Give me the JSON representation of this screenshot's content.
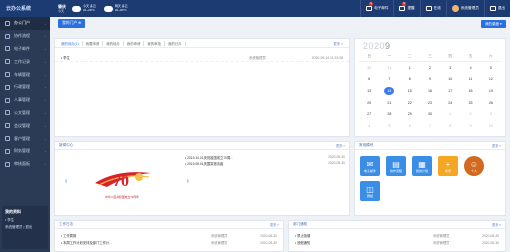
{
  "topbar": {
    "logo": "云办公系统",
    "city": "肇庆",
    "city_sub": "今天",
    "weather": [
      {
        "label": "今天 多云",
        "temp": "21~29°C"
      },
      {
        "label": "明天 多云",
        "temp": "22~30°C"
      }
    ],
    "items": [
      {
        "label": "电子邮件",
        "badge": "3"
      },
      {
        "label": "提醒",
        "badge": "5"
      },
      {
        "label": "在线",
        "badge": ""
      }
    ],
    "user": "系统管理员",
    "logout": "退出"
  },
  "sidebar": {
    "items": [
      {
        "label": "办公门户"
      },
      {
        "label": "协作流程"
      },
      {
        "label": "电子邮件"
      },
      {
        "label": "工作记录"
      },
      {
        "label": "车辆管理"
      },
      {
        "label": "行政管理"
      },
      {
        "label": "人事管理"
      },
      {
        "label": "公文管理"
      },
      {
        "label": "会议管理"
      },
      {
        "label": "客户管理"
      },
      {
        "label": "财务管理"
      },
      {
        "label": "审核面板"
      }
    ],
    "profile": {
      "title": "我的资料",
      "name": "• 李生",
      "role": "系统管理员 | 退出"
    }
  },
  "toolbar": {
    "add_label": "我的门户 ⊕",
    "tab_label": "我的桌面 ▾"
  },
  "tasks": {
    "tabs": [
      "我的待办(1)",
      "我要申请",
      "我的经办",
      "我的申请",
      "我的审批",
      "我的已办"
    ],
    "more": "更多 »",
    "rows": [
      {
        "title": "• 李生",
        "who": "系统管理员",
        "date": "2020-09-14 11:23:08"
      }
    ]
  },
  "calendar": {
    "year": "2020",
    "month": "9",
    "weekdays": [
      "日",
      "一",
      "二",
      "三",
      "四",
      "五",
      "六"
    ],
    "days": [
      {
        "d": "30",
        "dim": true
      },
      {
        "d": "31",
        "dim": true
      },
      {
        "d": "1"
      },
      {
        "d": "2"
      },
      {
        "d": "3"
      },
      {
        "d": "4"
      },
      {
        "d": "5"
      },
      {
        "d": "6"
      },
      {
        "d": "7"
      },
      {
        "d": "8"
      },
      {
        "d": "9"
      },
      {
        "d": "10"
      },
      {
        "d": "11"
      },
      {
        "d": "12"
      },
      {
        "d": "13"
      },
      {
        "d": "14",
        "today": true
      },
      {
        "d": "15"
      },
      {
        "d": "16"
      },
      {
        "d": "17"
      },
      {
        "d": "18"
      },
      {
        "d": "19"
      },
      {
        "d": "20"
      },
      {
        "d": "21"
      },
      {
        "d": "22"
      },
      {
        "d": "23"
      },
      {
        "d": "24"
      },
      {
        "d": "25"
      },
      {
        "d": "26"
      },
      {
        "d": "27"
      },
      {
        "d": "28"
      },
      {
        "d": "29"
      },
      {
        "d": "30"
      },
      {
        "d": "1",
        "dim": true
      },
      {
        "d": "2",
        "dim": true
      },
      {
        "d": "3",
        "dim": true
      },
      {
        "d": "4",
        "dim": true
      },
      {
        "d": "5",
        "dim": true
      },
      {
        "d": "6",
        "dim": true
      },
      {
        "d": "7",
        "dim": true
      },
      {
        "d": "8",
        "dim": true
      },
      {
        "d": "9",
        "dim": true
      },
      {
        "d": "10",
        "dim": true
      }
    ]
  },
  "news": {
    "title": "新闻中心",
    "more": "更多 »",
    "items": [
      {
        "title": "• 2019.10.01庆祝祖国成立70周...",
        "date": "2020-08-30"
      },
      {
        "title": "• 2019.08.01庆国宴邀请函",
        "date": "2020-08-30"
      }
    ],
    "banner_caption": "中华人民共和国成立70周年"
  },
  "quick": {
    "title": "常用模块",
    "more": "更多 »",
    "apps": [
      {
        "label": "电子邮件",
        "glyph": "✉",
        "color": "#3a8ee6"
      },
      {
        "label": "协作流程",
        "glyph": "▤",
        "color": "#3a8ee6"
      },
      {
        "label": "我的计划",
        "glyph": "▦",
        "color": "#3a8ee6"
      },
      {
        "label": "新增",
        "glyph": "+",
        "color": "#f5a623"
      },
      {
        "label": "个人",
        "glyph": "☺",
        "color": "#d2691e"
      },
      {
        "label": "群组",
        "glyph": "◫",
        "color": "#3a8ee6"
      }
    ]
  },
  "work": {
    "title": "工作日志",
    "more": "更多 »",
    "rows": [
      {
        "title": "• 工作周报",
        "who": "系统管理员",
        "date": "2020-08-30"
      },
      {
        "title": "• 本周工作计划安排及部门工作计...",
        "who": "系统管理员",
        "date": "2020-08-30"
      }
    ]
  },
  "notice": {
    "title": "部门通知",
    "more": "更多 »",
    "rows": [
      {
        "title": "• 禁止吸烟",
        "who": "系统管理员",
        "date": "2020-08-30"
      },
      {
        "title": "• 放假通知",
        "who": "系统管理员",
        "date": "2020-08-30"
      }
    ]
  }
}
